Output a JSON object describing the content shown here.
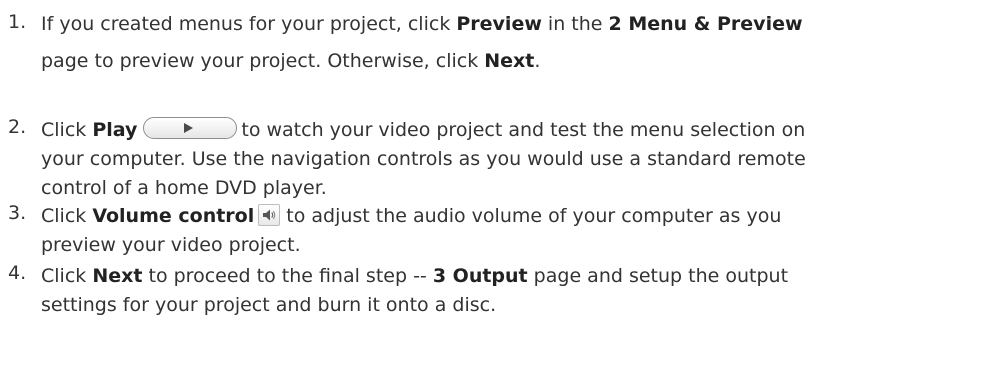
{
  "steps": [
    {
      "number": "1.",
      "t1": "If you created menus for your project, click ",
      "b1": "Preview",
      "t2": " in the ",
      "b2": "2 Menu & Preview",
      "t3": "page to preview your project. Otherwise, click ",
      "b3": "Next",
      "t4": "."
    },
    {
      "number": "2.",
      "t1": "Click ",
      "b1": "Play",
      "t2": "to watch your video project and test the menu selection on",
      "t3": "your computer. Use the navigation controls as you would use a standard remote",
      "t4": "control of a home DVD player.",
      "icon": "play-button-icon"
    },
    {
      "number": "3.",
      "t1": "Click ",
      "b1": "Volume control",
      "t2": "to adjust the audio volume of your computer as you",
      "t3": "preview your video project.",
      "icon": "volume-speaker-icon"
    },
    {
      "number": "4.",
      "t1": "Click ",
      "b1": "Next",
      "t2": " to proceed to the final step -- ",
      "b2": "3 Output",
      "t3": " page and setup the output",
      "t4": "settings for your project and burn it onto a disc."
    }
  ]
}
